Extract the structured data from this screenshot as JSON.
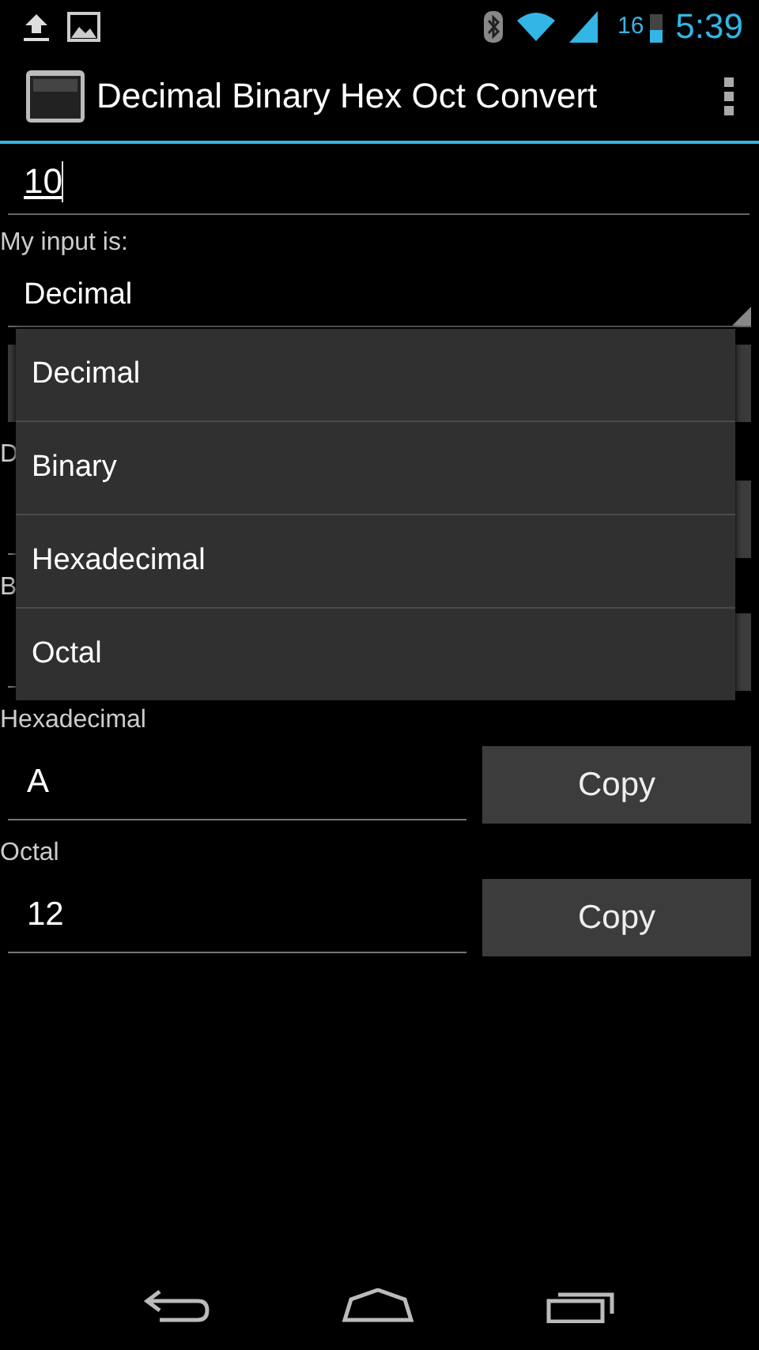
{
  "status_bar": {
    "battery_percent": "16",
    "time": "5:39"
  },
  "action_bar": {
    "title": "Decimal Binary Hex Oct Convert"
  },
  "input": {
    "value": "10"
  },
  "input_type": {
    "label": "My input is:",
    "value": "Decimal"
  },
  "dropdown": {
    "options": [
      "Decimal",
      "Binary",
      "Hexadecimal",
      "Octal"
    ]
  },
  "results": [
    {
      "label": "D"
    },
    {
      "label": "B"
    },
    {
      "label": "Hexadecimal",
      "value": "A",
      "button": "Copy"
    },
    {
      "label": "Octal",
      "value": "12",
      "button": "Copy"
    }
  ]
}
